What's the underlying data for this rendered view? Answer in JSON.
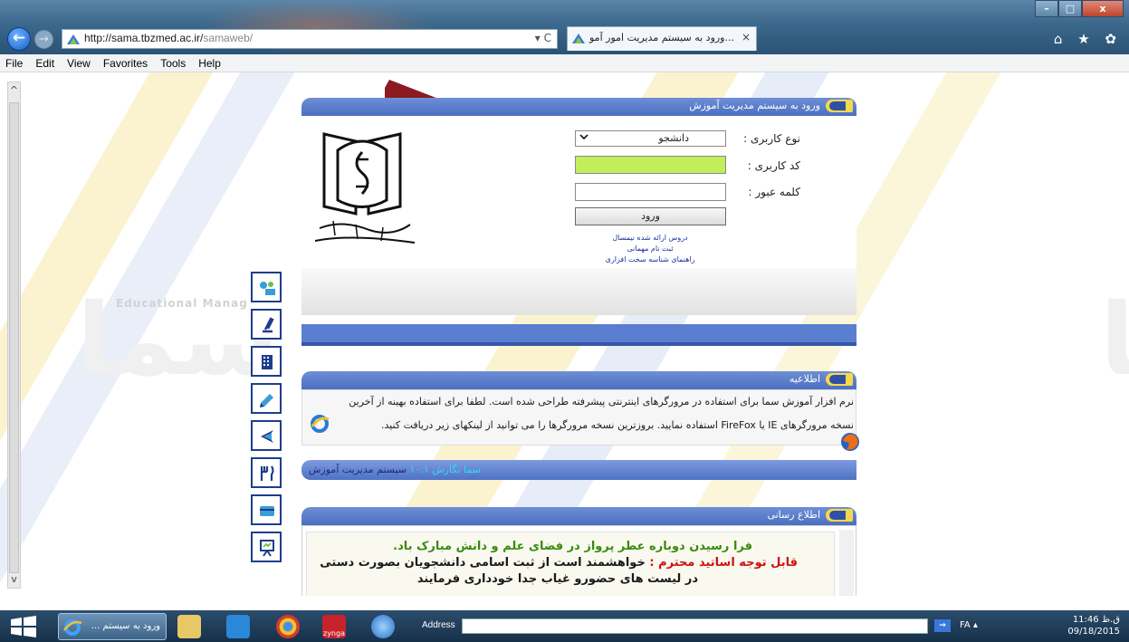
{
  "browser": {
    "url_host": "http://sama.tbzmed.ac.ir/",
    "url_path": "samaweb/",
    "address_controls": "▾ C",
    "tab_title": "...ورود به سیستم مدیریت امور آمو",
    "tab_close": "×",
    "nav_icons": "⌂ ★ ✿"
  },
  "menu": {
    "file": "File",
    "edit": "Edit",
    "view": "View",
    "favorites": "Favorites",
    "tools": "Tools",
    "help": "Help"
  },
  "watermark": {
    "logo_text": "سما",
    "subtitle": "Educational Manag"
  },
  "login_panel": {
    "header": "ورود به سیستم مدیریت آموزش",
    "user_type_label": "نوع کاربری :",
    "user_type_value": "دانشجو",
    "user_code_label": "کد کاربری :",
    "user_code_value": "",
    "password_label": "کلمه عبور :",
    "password_value": "",
    "login_button": "ورود",
    "links": [
      "دروس ارائه شده نیمسال",
      "ثبت نام مهمانی",
      "راهنمای شناسه سخت افزاری"
    ]
  },
  "notice_panel": {
    "header": "اطلاعیه",
    "line1": "نرم افزار آموزش سما برای استفاده در مرورگرهای اینترنتی پیشرفته طراحی شده است. لطفا برای استفاده بهینه از آخرین",
    "line2": "نسخه مرورگرهای IE یا FireFox استفاده نمایید. بروزترین نسخه مرورگرها را می توانید از لینکهای زیر دریافت کنید."
  },
  "system_bar": {
    "text": "سیستم مدیریت آموزش",
    "version": "سما نگارش ۱۰.۱"
  },
  "inform_panel": {
    "header": "اطلاع رسانی",
    "msg1": "فرا رسیدن دوباره عطر پرواز در فضای علم و دانش مبارک باد.",
    "msg2_highlight": "قابل توجه اساتید محترم :",
    "msg2": "خواهشمند است از ثبت اسامی دانشجویان بصورت دستی",
    "msg3": "در لیست های حضورو غیاب جدا خودداری فرمایند"
  },
  "taskbar": {
    "ie_task": "ورود به سیستم ...",
    "address_label": "Address",
    "tray": "FA  ▴",
    "zynga": "zynga",
    "time": "11:46 ق.ظ",
    "date": "09/18/2015"
  },
  "colors": {
    "panel_header": "#4b6fc2",
    "user_code_bg": "#c2ee5a",
    "arrow": "#8b1a22",
    "stripe_yellow": "#fbf3d0",
    "stripe_blue": "#e6ecf8"
  }
}
